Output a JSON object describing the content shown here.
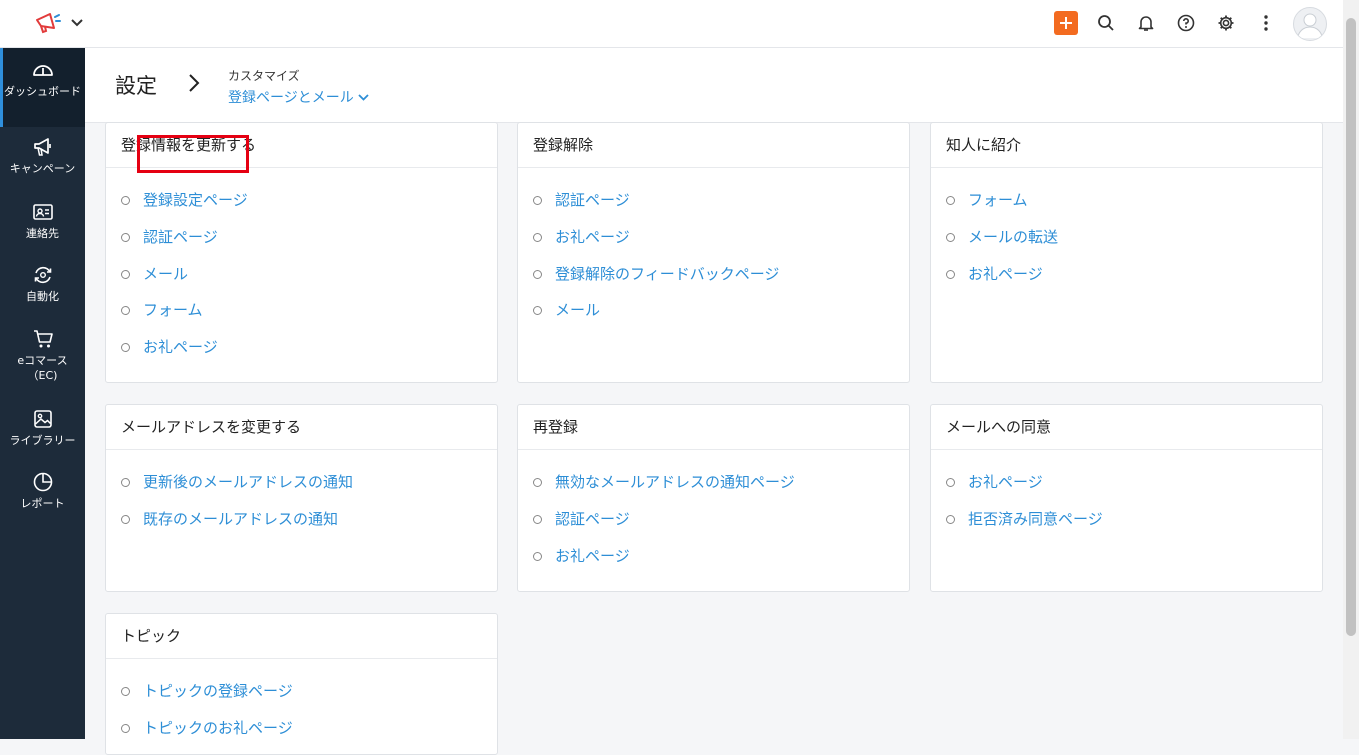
{
  "header": {
    "title": "設定",
    "breadcrumb_parent": "カスタマイズ",
    "breadcrumb_current": "登録ページとメール"
  },
  "sidebar": {
    "items": [
      {
        "label": "ダッシュボード",
        "icon": "dashboard-gauge-icon"
      },
      {
        "label": "キャンペーン",
        "icon": "megaphone-icon"
      },
      {
        "label": "連絡先",
        "icon": "contact-card-icon"
      },
      {
        "label": "自動化",
        "icon": "automation-icon"
      },
      {
        "label": "eコマース（EC)",
        "icon": "cart-icon"
      },
      {
        "label": "ライブラリー",
        "icon": "image-library-icon"
      },
      {
        "label": "レポート",
        "icon": "pie-chart-icon"
      }
    ]
  },
  "toolbar": {
    "icons": [
      "plus-icon",
      "search-icon",
      "bell-icon",
      "help-icon",
      "gear-icon",
      "more-vertical-icon",
      "avatar"
    ],
    "accent": "#f36b20"
  },
  "cards": [
    {
      "title": "登録情報を更新する",
      "links": [
        "登録設定ページ",
        "認証ページ",
        "メール",
        "フォーム",
        "お礼ページ"
      ]
    },
    {
      "title": "登録解除",
      "links": [
        "認証ページ",
        "お礼ページ",
        "登録解除のフィードバックページ",
        "メール"
      ]
    },
    {
      "title": "知人に紹介",
      "links": [
        "フォーム",
        "メールの転送",
        "お礼ページ"
      ]
    },
    {
      "title": "メールアドレスを変更する",
      "links": [
        "更新後のメールアドレスの通知",
        "既存のメールアドレスの通知"
      ]
    },
    {
      "title": "再登録",
      "links": [
        "無効なメールアドレスの通知ページ",
        "認証ページ",
        "お礼ページ"
      ]
    },
    {
      "title": "メールへの同意",
      "links": [
        "お礼ページ",
        "拒否済み同意ページ"
      ]
    },
    {
      "title": "トピック",
      "links": [
        "トピックの登録ページ",
        "トピックのお礼ページ"
      ]
    }
  ],
  "colors": {
    "sidebar_bg": "#1d2b3a",
    "link": "#2d8ed6",
    "highlight": "#e50012"
  }
}
